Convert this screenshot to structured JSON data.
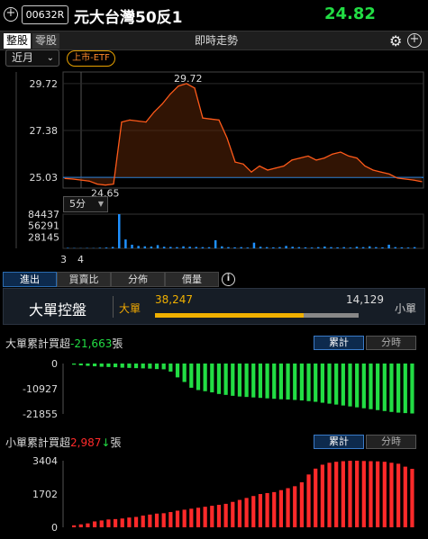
{
  "header": {
    "stock_code": "00632R",
    "stock_name": "元大台灣50反1",
    "price": "24.82"
  },
  "toolbar": {
    "lot_whole": "整股",
    "lot_odd": "零股",
    "view_title": "即時走勢"
  },
  "filters": {
    "month": "近月",
    "badge": "上市-ETF",
    "period": "5分"
  },
  "price_chart": {
    "y_ticks": [
      "29.72",
      "27.38",
      "25.03"
    ],
    "high_label": "29.72",
    "low_label": "24.65",
    "volume_ticks": [
      "84437",
      "56291",
      "28145"
    ],
    "x_labels": [
      "3",
      "4"
    ]
  },
  "tabs": [
    "進出",
    "買賣比",
    "分佈",
    "價量"
  ],
  "big_order": {
    "title": "大單控盤",
    "big_label": "大單",
    "small_label": "小單",
    "big_value": "38,247",
    "small_value": "14,129",
    "big_ratio": 0.73
  },
  "big_cum": {
    "title_prefix": "大單累計買超",
    "value": "-21,663",
    "unit": "張",
    "y_ticks": [
      "0",
      "-10927",
      "-21855"
    ],
    "toggle_cum": "累計",
    "toggle_time": "分時"
  },
  "small_cum": {
    "title_prefix": "小單累計買超",
    "value": "2,987",
    "unit": "張",
    "y_ticks": [
      "3404",
      "1702",
      "0"
    ],
    "toggle_cum": "累計",
    "toggle_time": "分時"
  },
  "colors": {
    "up": "#ff2a2a",
    "down": "#22dd44",
    "price_line": "#ff5a1a",
    "volume": "#1e90ff",
    "accent": "#f0b000"
  },
  "icons": {
    "add": "plus-circle-icon",
    "gear": "gear-icon",
    "info": "info-icon"
  },
  "chart_data": [
    {
      "type": "line",
      "title": "",
      "ylim": [
        24.5,
        30.3
      ],
      "y_ticks": [
        29.72,
        27.38,
        25.03
      ],
      "series": [
        {
          "values": [
            24.98,
            24.95,
            24.9,
            24.85,
            24.7,
            24.65,
            24.7,
            27.8,
            27.9,
            27.85,
            27.8,
            28.3,
            28.7,
            29.2,
            29.6,
            29.72,
            29.5,
            28.0,
            27.95,
            27.9,
            27.0,
            25.8,
            25.7,
            25.3,
            25.6,
            25.4,
            25.5,
            25.6,
            25.9,
            26.0,
            26.1,
            25.9,
            26.0,
            26.2,
            26.3,
            26.1,
            26.0,
            25.6,
            25.4,
            25.3,
            25.2,
            25.0,
            24.95,
            24.9,
            24.82
          ]
        }
      ],
      "reference": 25.03
    },
    {
      "type": "bar",
      "title": "",
      "y_ticks": [
        84437,
        56291,
        28145
      ],
      "ylim": [
        0,
        84437
      ],
      "values": [
        1200,
        800,
        600,
        900,
        700,
        1500,
        2000,
        3500,
        84437,
        22000,
        9000,
        6000,
        5000,
        4500,
        8000,
        4000,
        3500,
        3000,
        5000,
        4000,
        3500,
        3000,
        2800,
        20000,
        5000,
        3000,
        2500,
        3000,
        2000,
        14000,
        4000,
        3000,
        2500,
        3000,
        6000,
        4000,
        3000,
        2500,
        2000,
        3000,
        4500,
        3000,
        2500,
        3000,
        2000,
        4000,
        3000,
        5000,
        3000,
        2500,
        9000,
        3000,
        2500,
        2000,
        3000
      ]
    },
    {
      "type": "bar",
      "title": "",
      "y_ticks": [
        0,
        -10927,
        -21855
      ],
      "ylim": [
        -21855,
        0
      ],
      "values": [
        -500,
        -800,
        -1000,
        -1200,
        -1400,
        -1500,
        -1600,
        -1800,
        -1900,
        -2000,
        -2100,
        -2200,
        -2400,
        -2500,
        -3500,
        -6000,
        -8000,
        -10500,
        -11500,
        -12000,
        -12500,
        -13200,
        -13600,
        -14000,
        -14300,
        -14500,
        -14700,
        -14900,
        -15100,
        -15300,
        -15500,
        -15600,
        -15800,
        -16000,
        -16300,
        -16600,
        -17000,
        -17400,
        -17800,
        -18200,
        -18600,
        -19000,
        -19400,
        -19800,
        -20200,
        -20600,
        -21000,
        -21300,
        -21500,
        -21663
      ]
    },
    {
      "type": "bar",
      "title": "",
      "y_ticks": [
        3404,
        1702,
        0
      ],
      "ylim": [
        0,
        3404
      ],
      "values": [
        100,
        150,
        200,
        300,
        350,
        400,
        420,
        450,
        500,
        530,
        600,
        650,
        700,
        720,
        780,
        850,
        900,
        950,
        1000,
        1050,
        1100,
        1150,
        1200,
        1300,
        1400,
        1500,
        1600,
        1700,
        1750,
        1800,
        1900,
        2000,
        2100,
        2300,
        2700,
        3000,
        3200,
        3300,
        3350,
        3380,
        3400,
        3404,
        3390,
        3380,
        3370,
        3350,
        3300,
        3250,
        3100,
        2987
      ]
    }
  ]
}
